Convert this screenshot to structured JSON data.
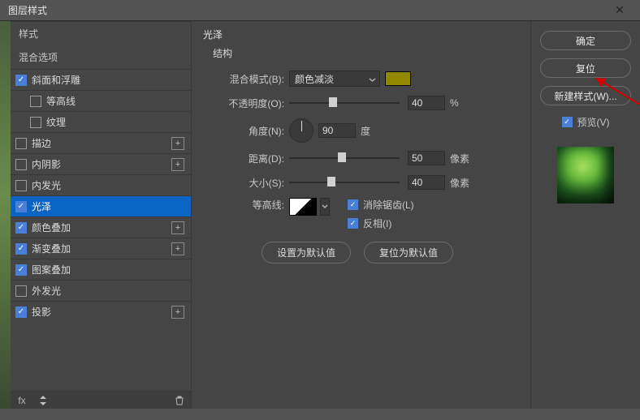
{
  "dialog": {
    "title": "图层样式"
  },
  "sidebar": {
    "styles_label": "样式",
    "blend_options_label": "混合选项",
    "items": [
      {
        "label": "斜面和浮雕",
        "checked": true,
        "plus": false,
        "indent": false
      },
      {
        "label": "等高线",
        "checked": false,
        "plus": false,
        "indent": true
      },
      {
        "label": "纹理",
        "checked": false,
        "plus": false,
        "indent": true
      },
      {
        "label": "描边",
        "checked": false,
        "plus": true,
        "indent": false
      },
      {
        "label": "内阴影",
        "checked": false,
        "plus": true,
        "indent": false
      },
      {
        "label": "内发光",
        "checked": false,
        "plus": false,
        "indent": false
      },
      {
        "label": "光泽",
        "checked": true,
        "plus": false,
        "indent": false,
        "selected": true
      },
      {
        "label": "颜色叠加",
        "checked": true,
        "plus": true,
        "indent": false
      },
      {
        "label": "渐变叠加",
        "checked": true,
        "plus": true,
        "indent": false
      },
      {
        "label": "图案叠加",
        "checked": true,
        "plus": false,
        "indent": false
      },
      {
        "label": "外发光",
        "checked": false,
        "plus": false,
        "indent": false
      },
      {
        "label": "投影",
        "checked": true,
        "plus": true,
        "indent": false
      }
    ],
    "footer": {
      "fx": "fx"
    }
  },
  "panel": {
    "title": "光泽",
    "group": "结构",
    "blend_mode_label": "混合模式(B):",
    "blend_mode_value": "颜色减淡",
    "color": "#918800",
    "opacity_label": "不透明度(O):",
    "opacity_value": "40",
    "opacity_unit": "%",
    "angle_label": "角度(N):",
    "angle_value": "90",
    "angle_unit": "度",
    "distance_label": "距离(D):",
    "distance_value": "50",
    "distance_unit": "像素",
    "size_label": "大小(S):",
    "size_value": "40",
    "size_unit": "像素",
    "contour_label": "等高线:",
    "antialias_label": "消除锯齿(L)",
    "invert_label": "反相(I)",
    "set_default": "设置为默认值",
    "reset_default": "复位为默认值"
  },
  "right": {
    "ok": "确定",
    "reset": "复位",
    "new_style": "新建样式(W)...",
    "preview_label": "预览(V)"
  },
  "annotation": {
    "color_code": "#918800"
  }
}
